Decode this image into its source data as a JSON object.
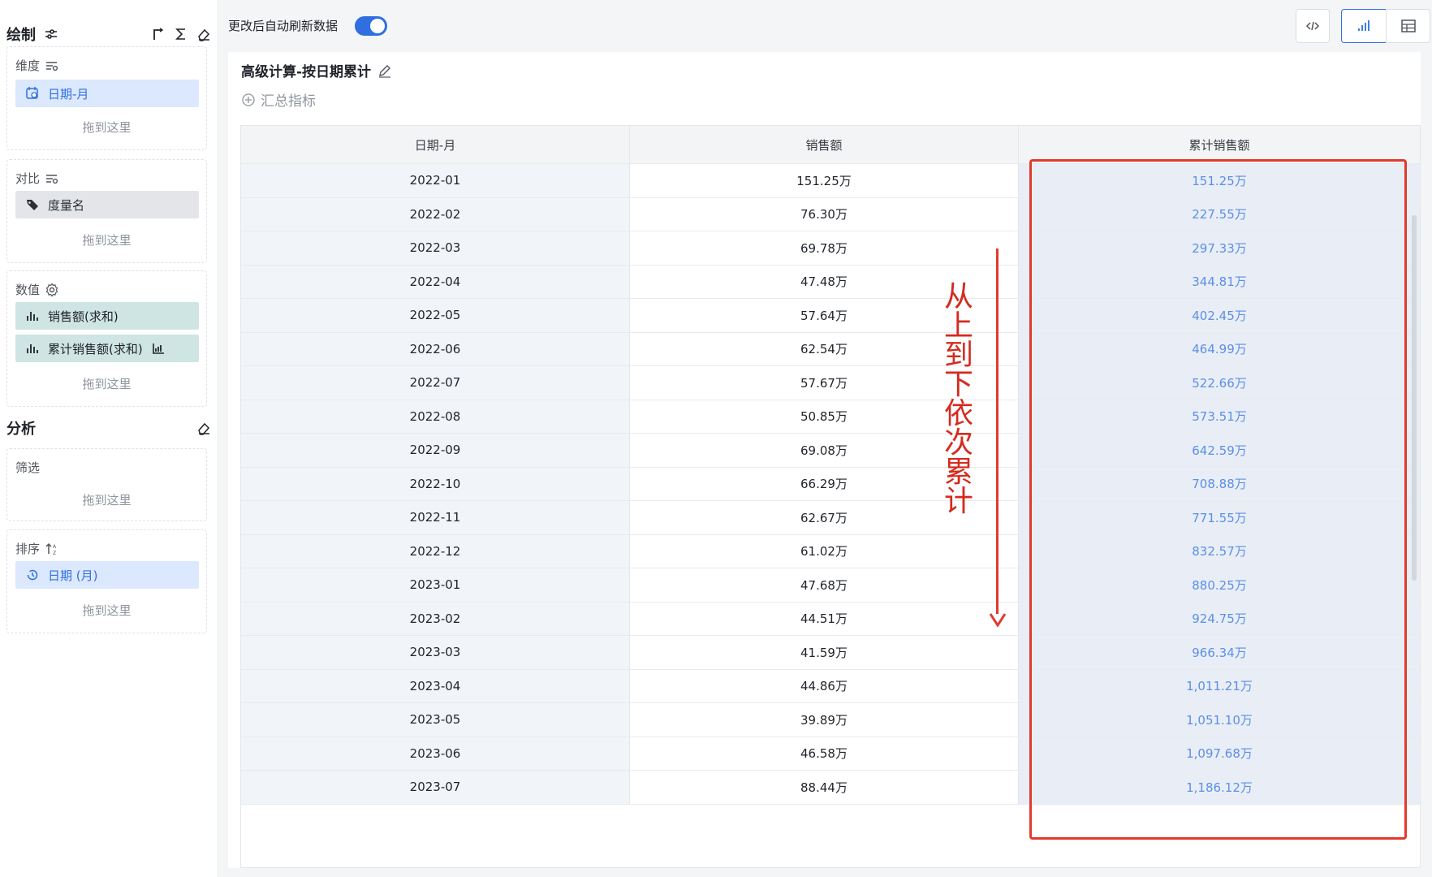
{
  "left_panel": {
    "draw_title": "绘制",
    "dimension": {
      "title": "维度",
      "field": "日期-月",
      "drop": "拖到这里"
    },
    "compare": {
      "title": "对比",
      "field": "度量名",
      "drop": "拖到这里"
    },
    "values": {
      "title": "数值",
      "fields": [
        "销售额(求和)",
        "累计销售额(求和)"
      ],
      "drop": "拖到这里"
    },
    "analysis_title": "分析",
    "filter": {
      "title": "筛选",
      "drop": "拖到这里"
    },
    "sort": {
      "title": "排序",
      "field": "日期 (月)",
      "drop": "拖到这里"
    }
  },
  "topbar": {
    "auto_refresh_label": "更改后自动刷新数据",
    "auto_refresh_on": true
  },
  "card": {
    "title": "高级计算-按日期累计",
    "summary_label": "汇总指标"
  },
  "table": {
    "headers": [
      "日期-月",
      "销售额",
      "累计销售额"
    ],
    "rows": [
      [
        "2022-01",
        "151.25万",
        "151.25万"
      ],
      [
        "2022-02",
        "76.30万",
        "227.55万"
      ],
      [
        "2022-03",
        "69.78万",
        "297.33万"
      ],
      [
        "2022-04",
        "47.48万",
        "344.81万"
      ],
      [
        "2022-05",
        "57.64万",
        "402.45万"
      ],
      [
        "2022-06",
        "62.54万",
        "464.99万"
      ],
      [
        "2022-07",
        "57.67万",
        "522.66万"
      ],
      [
        "2022-08",
        "50.85万",
        "573.51万"
      ],
      [
        "2022-09",
        "69.08万",
        "642.59万"
      ],
      [
        "2022-10",
        "66.29万",
        "708.88万"
      ],
      [
        "2022-11",
        "62.67万",
        "771.55万"
      ],
      [
        "2022-12",
        "61.02万",
        "832.57万"
      ],
      [
        "2023-01",
        "47.68万",
        "880.25万"
      ],
      [
        "2023-02",
        "44.51万",
        "924.75万"
      ],
      [
        "2023-03",
        "41.59万",
        "966.34万"
      ],
      [
        "2023-04",
        "44.86万",
        "1,011.21万"
      ],
      [
        "2023-05",
        "39.89万",
        "1,051.10万"
      ],
      [
        "2023-06",
        "46.58万",
        "1,097.68万"
      ],
      [
        "2023-07",
        "88.44万",
        "1,186.12万"
      ]
    ]
  },
  "annotation": {
    "text": "从上到下依次累计",
    "color": "#e23a2c"
  },
  "colors": {
    "accent": "#2f6fe0",
    "annotation": "#e23a2c"
  }
}
